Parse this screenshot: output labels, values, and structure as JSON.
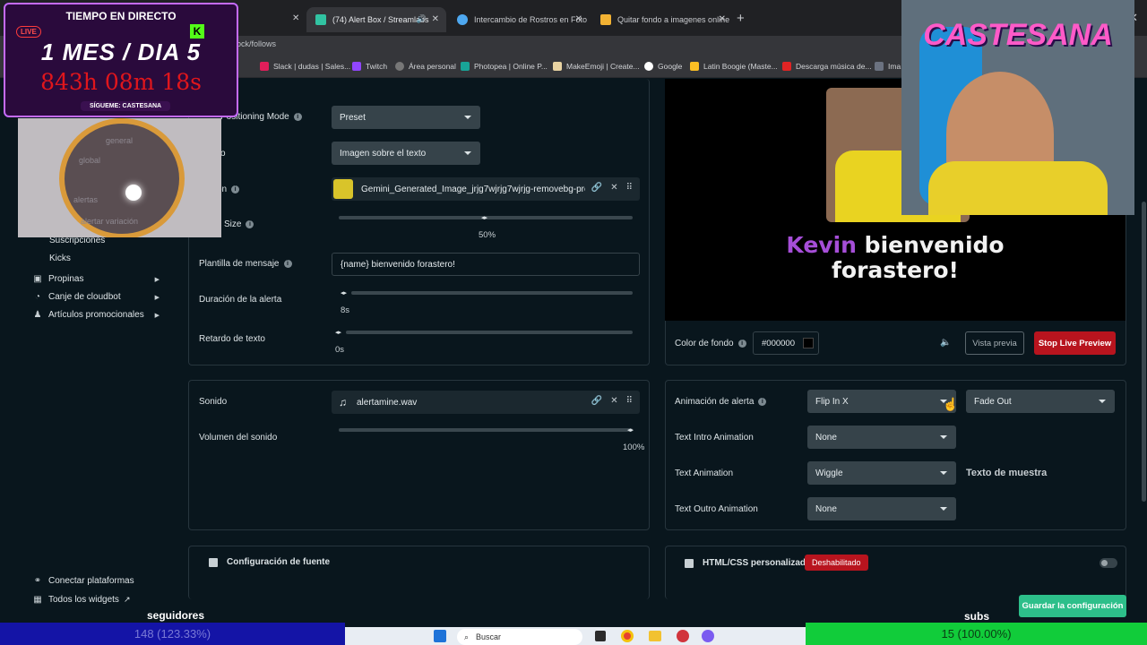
{
  "browser": {
    "tabs": [
      {
        "label": "(74) Alert Box / Streamlabs"
      },
      {
        "label": "Intercambio de Rostros en Foto"
      },
      {
        "label": "Quitar fondo a imagenes online"
      }
    ],
    "url": "lock/follows",
    "bookmarks": [
      "Slack | dudas | Sales...",
      "Twitch",
      "Área personal",
      "Photopea | Online P...",
      "MakeEmoji | Create...",
      "Google",
      "Latin Boogie (Maste...",
      "Descarga música de...",
      "Ima"
    ]
  },
  "overlay": {
    "title": "TIEMPO EN DIRECTO",
    "live": "LIVE",
    "date": "1 MES / DIA 5",
    "timer": "843h 08m 18s",
    "follow": "SÍGUEME: CASTESANA",
    "brand": "CASTESANA"
  },
  "sidebar": {
    "ghost": [
      "general",
      "global",
      "alertas",
      "alertar variación"
    ],
    "subitems": [
      "Suscripciones",
      "Kicks"
    ],
    "items": [
      {
        "label": "Propinas",
        "icon": "coin-icon"
      },
      {
        "label": "Canje de cloudbot",
        "icon": "gift-icon"
      },
      {
        "label": "Artículos promocionales",
        "icon": "shirt-icon"
      }
    ],
    "footer": [
      {
        "label": "Conectar plataformas",
        "icon": "link-icon"
      },
      {
        "label": "Todos los widgets",
        "icon": "grid-icon"
      }
    ]
  },
  "settings": {
    "layout_mode_label": "Positioning Mode",
    "layout_mode_value": "Preset",
    "layout_label": "o",
    "layout_value": "Imagen sobre el texto",
    "image_label": "on",
    "image_file": "Gemini_Generated_Image_jrjg7wjrjg7wjrjg-removebg-previ...",
    "image_size_label": "Size",
    "image_size_value": "50%",
    "template_label": "Plantilla de mensaje",
    "template_value": "{name} bienvenido forastero!",
    "duration_label": "Duración de la alerta",
    "duration_value": "8s",
    "delay_label": "Retardo de texto",
    "delay_value": "0s"
  },
  "sound": {
    "label": "Sonido",
    "file": "alertamine.wav",
    "volume_label": "Volumen del sonido",
    "volume_value": "100%"
  },
  "preview": {
    "name": "Kevin",
    "line1_rest": " bienvenido",
    "line2": "forastero!",
    "bg_label": "Color de fondo",
    "bg_value": "#000000",
    "preview_btn": "Vista previa",
    "stop_btn": "Stop Live Preview"
  },
  "animation": {
    "alert_label": "Animación de alerta",
    "alert_in": "Flip In X",
    "alert_out": "Fade Out",
    "intro_label": "Text Intro Animation",
    "intro_value": "None",
    "text_label": "Text Animation",
    "text_value": "Wiggle",
    "sample": "Texto de muestra",
    "outro_label": "Text Outro Animation",
    "outro_value": "None"
  },
  "font_section": "Configuración de fuente",
  "html_section": "HTML/CSS personalizado",
  "html_status": "Deshabilitado",
  "save_button": "Guardar la configuración",
  "stream": {
    "seguidores_label": "seguidores",
    "seguidores_value": "148 (123.33%)",
    "subs_label": "subs",
    "subs_value": "15 (100.00%)"
  },
  "taskbar": {
    "search": "Buscar"
  }
}
